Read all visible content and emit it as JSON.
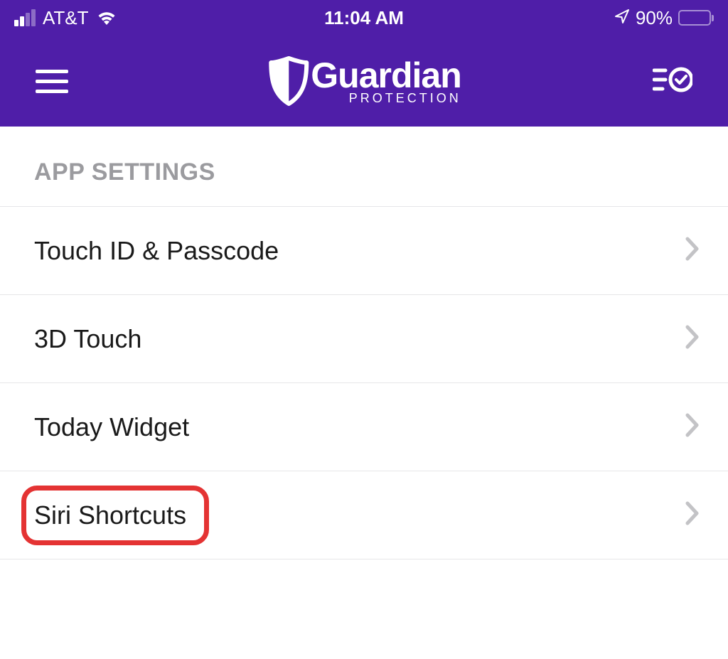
{
  "status_bar": {
    "carrier": "AT&T",
    "time": "11:04 AM",
    "battery_percent": "90%"
  },
  "header": {
    "logo_main": "Guardian",
    "logo_sub": "PROTECTION"
  },
  "section_title": "APP SETTINGS",
  "settings_items": [
    {
      "label": "Touch ID & Passcode"
    },
    {
      "label": "3D Touch"
    },
    {
      "label": "Today Widget"
    },
    {
      "label": "Siri Shortcuts"
    }
  ],
  "colors": {
    "brand_purple": "#4f1ea8",
    "highlight_red": "#e43333"
  }
}
